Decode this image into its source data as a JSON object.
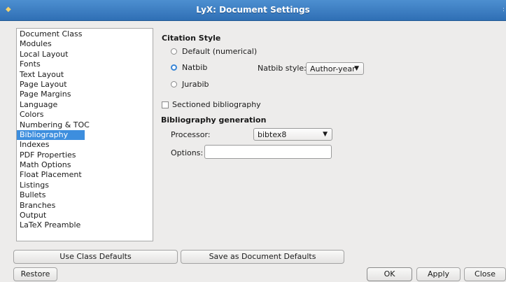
{
  "window": {
    "title": "LyX: Document Settings"
  },
  "nav": {
    "items": [
      "Document Class",
      "Modules",
      "Local Layout",
      "Fonts",
      "Text Layout",
      "Page Layout",
      "Page Margins",
      "Language",
      "Colors",
      "Numbering & TOC",
      "Bibliography",
      "Indexes",
      "PDF Properties",
      "Math Options",
      "Float Placement",
      "Listings",
      "Bullets",
      "Branches",
      "Output",
      "LaTeX Preamble"
    ],
    "selected": "Bibliography"
  },
  "citation": {
    "heading": "Citation Style",
    "default_label": "Default (numerical)",
    "natbib_label": "Natbib",
    "jurabib_label": "Jurabib",
    "selected": "Natbib",
    "natbib_style_label": "Natbib style:",
    "natbib_style_value": "Author-year"
  },
  "sectioned": {
    "label": "Sectioned bibliography",
    "checked": false
  },
  "generation": {
    "heading": "Bibliography generation",
    "processor_label": "Processor:",
    "processor_value": "bibtex8",
    "options_label": "Options:",
    "options_value": ""
  },
  "buttons": {
    "use_class_defaults": "Use Class Defaults",
    "save_doc_defaults": "Save as Document Defaults",
    "restore": "Restore",
    "ok": "OK",
    "apply": "Apply",
    "close": "Close"
  },
  "colors": {
    "titlebar": "#3a7cc3",
    "selection": "#3d8ede",
    "window_bg": "#edeceb"
  }
}
